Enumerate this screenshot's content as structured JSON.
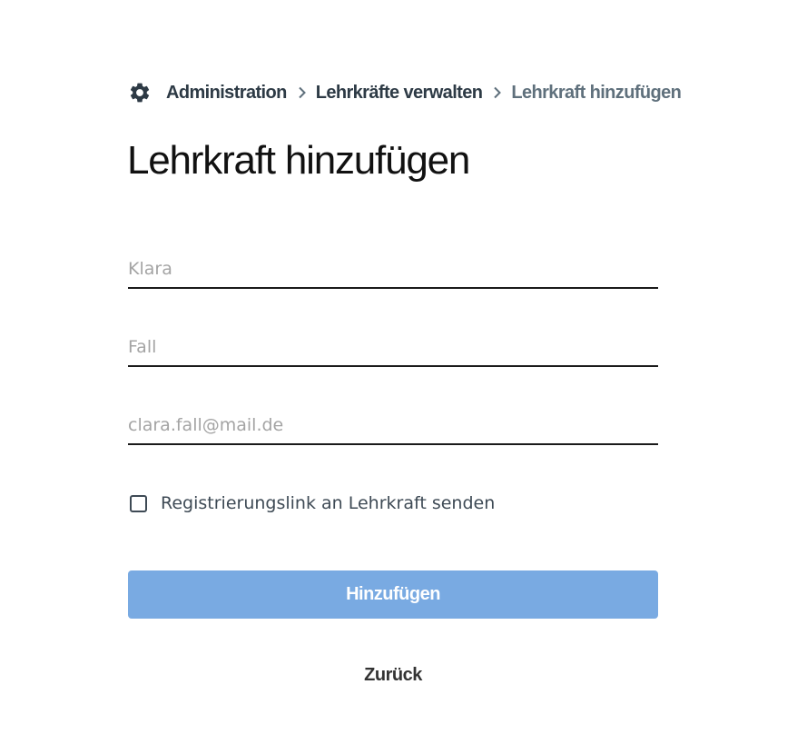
{
  "breadcrumb": {
    "icon": "gear-icon",
    "items": [
      {
        "label": "Administration"
      },
      {
        "label": "Lehrkräfte verwalten"
      },
      {
        "label": "Lehrkraft hinzufügen"
      }
    ]
  },
  "page": {
    "title": "Lehrkraft hinzufügen"
  },
  "form": {
    "first_name": {
      "value": "",
      "placeholder": "Klara"
    },
    "last_name": {
      "value": "",
      "placeholder": "Fall"
    },
    "email": {
      "value": "",
      "placeholder": "clara.fall@mail.de"
    },
    "send_registration_link": {
      "label": "Registrierungslink an Lehrkraft senden",
      "checked": false
    },
    "submit_label": "Hinzufügen",
    "back_label": "Zurück"
  },
  "colors": {
    "primary_button": "#79aae2",
    "breadcrumb_text": "#2d3a45",
    "breadcrumb_current": "#5f707c",
    "input_placeholder": "#a4a4a4"
  }
}
